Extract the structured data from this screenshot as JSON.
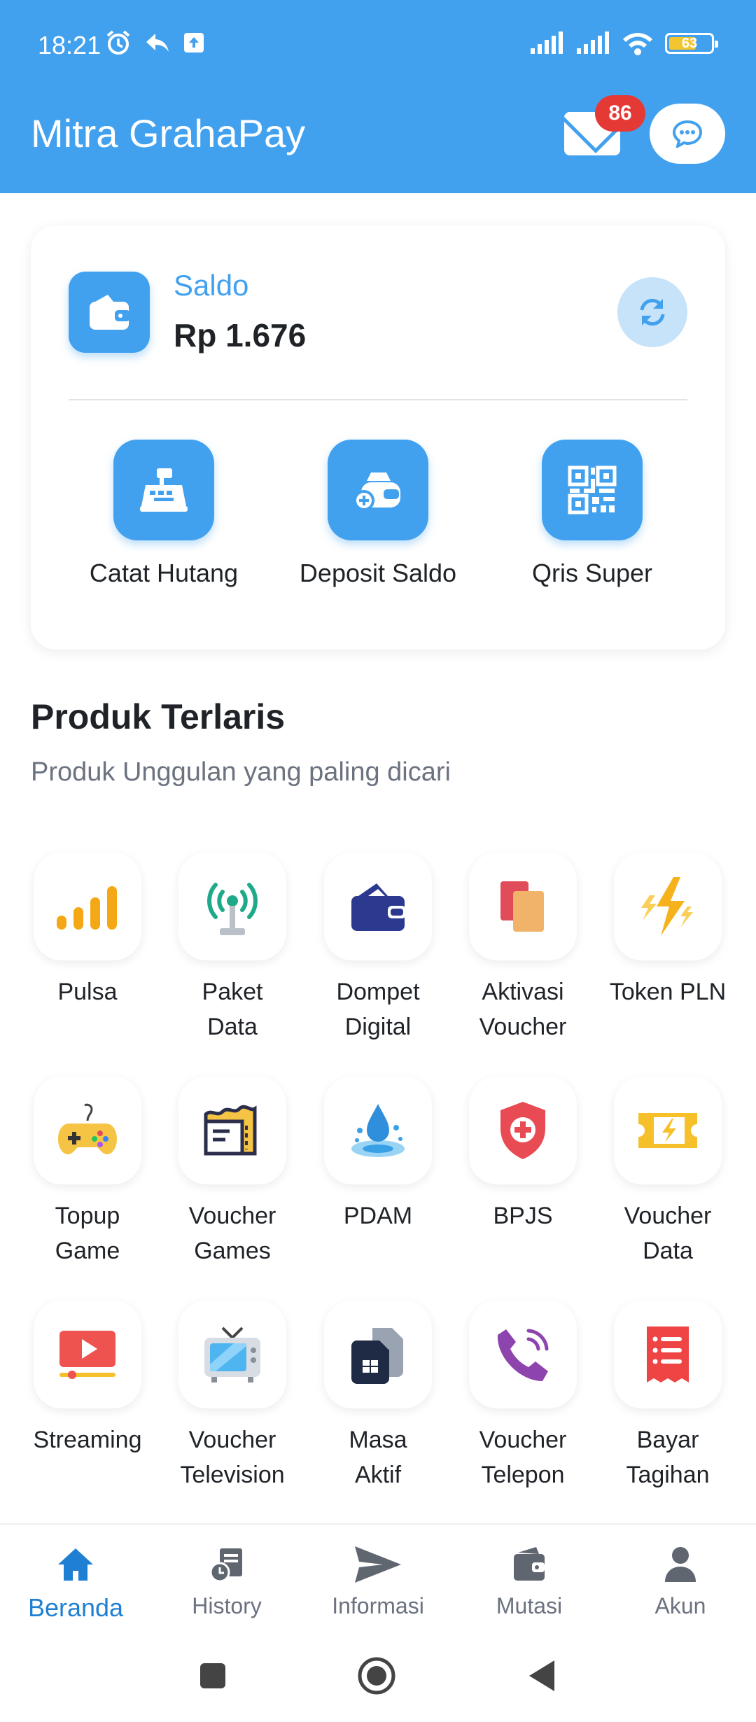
{
  "status_bar": {
    "time": "18:21",
    "battery_level": "63"
  },
  "app_bar": {
    "title": "Mitra GrahaPay",
    "mail_badge": "86"
  },
  "balance": {
    "label": "Saldo",
    "value": "Rp 1.676"
  },
  "actions": [
    {
      "label": "Catat Hutang",
      "icon": "cash-register-icon"
    },
    {
      "label": "Deposit Saldo",
      "icon": "deposit-money-icon"
    },
    {
      "label": "Qris Super",
      "icon": "qr-code-icon"
    }
  ],
  "section": {
    "title": "Produk Terlaris",
    "subtitle": "Produk Unggulan yang paling dicari"
  },
  "products": [
    {
      "label": "Pulsa",
      "icon": "signal-bars-icon"
    },
    {
      "label": "Paket\nData",
      "icon": "antenna-icon"
    },
    {
      "label": "Dompet\nDigital",
      "icon": "wallet-icon"
    },
    {
      "label": "Aktivasi\nVoucher",
      "icon": "voucher-cards-icon"
    },
    {
      "label": "Token PLN",
      "icon": "lightning-icon"
    },
    {
      "label": "Topup\nGame",
      "icon": "gamepad-icon"
    },
    {
      "label": "Voucher\nGames",
      "icon": "game-voucher-icon"
    },
    {
      "label": "PDAM",
      "icon": "water-drop-icon"
    },
    {
      "label": "BPJS",
      "icon": "health-shield-icon"
    },
    {
      "label": "Voucher\nData",
      "icon": "data-ticket-icon"
    },
    {
      "label": "Streaming",
      "icon": "play-video-icon"
    },
    {
      "label": "Voucher\nTelevision",
      "icon": "tv-icon"
    },
    {
      "label": "Masa\nAktif",
      "icon": "sim-card-icon"
    },
    {
      "label": "Voucher\nTelepon",
      "icon": "phone-icon"
    },
    {
      "label": "Bayar\nTagihan",
      "icon": "bill-receipt-icon"
    }
  ],
  "bottom_nav": [
    {
      "label": "Beranda",
      "icon": "home-icon",
      "active": true
    },
    {
      "label": "History",
      "icon": "history-icon"
    },
    {
      "label": "Informasi",
      "icon": "send-icon"
    },
    {
      "label": "Mutasi",
      "icon": "mutation-wallet-icon"
    },
    {
      "label": "Akun",
      "icon": "user-icon"
    }
  ],
  "colors": {
    "primary": "#42a1ef",
    "badge": "#e53935",
    "active_nav": "#1f7fd3"
  }
}
